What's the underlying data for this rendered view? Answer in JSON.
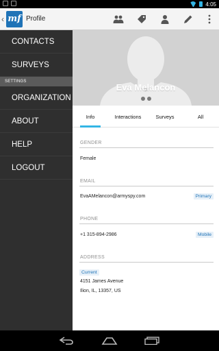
{
  "status_bar": {
    "time": "4:05"
  },
  "action_bar": {
    "logo_text": "mf",
    "title": "Profile",
    "actions": [
      "group-icon",
      "tag-icon",
      "person-icon",
      "pencil-icon",
      "overflow-menu-icon"
    ]
  },
  "drawer": {
    "items_top": [
      "CONTACTS",
      "SURVEYS"
    ],
    "section_header": "SETTINGS",
    "items_bottom": [
      "ORGANIZATION",
      "ABOUT",
      "HELP",
      "LOGOUT"
    ]
  },
  "profile": {
    "name": "Eva Melancon",
    "photo_pages": 2,
    "photo_current_page": 2
  },
  "tabs": [
    "Info",
    "Interactions",
    "Surveys",
    "All"
  ],
  "active_tab": "Info",
  "info": {
    "gender": {
      "label": "GENDER",
      "value": "Female"
    },
    "email": {
      "label": "EMAIL",
      "value": "EvaAMelancon@armyspy.com",
      "tag": "Primary"
    },
    "phone": {
      "label": "PHONE",
      "value": "+1 315-894-2986",
      "tag": "Mobile"
    },
    "address": {
      "label": "ADDRESS",
      "tag": "Current",
      "line1": "4151 James Avenue",
      "line2": "Ilion, IL, 13357, US"
    }
  },
  "colors": {
    "accent": "#33b5e5",
    "brand": "#1f73b7",
    "drawer_bg": "#2f2f2f",
    "hero_bg": "#d2d2d2"
  }
}
